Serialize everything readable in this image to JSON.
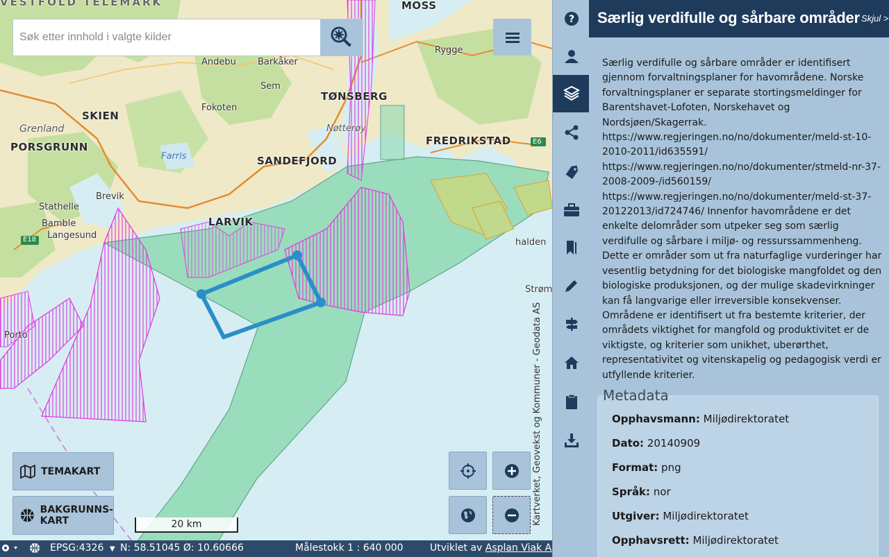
{
  "search": {
    "placeholder": "Søk etter innhold i valgte kilder"
  },
  "map": {
    "labels": {
      "skien": "SKIEN",
      "grenland": "Grenland",
      "porsgrunn": "PORSGRUNN",
      "farris": "Farris",
      "brevik": "Brevik",
      "stathelle": "Stathelle",
      "bamble": "Bamble",
      "langesund": "Langesund",
      "larvik": "LARVIK",
      "sandefjord": "SANDEFJORD",
      "tonsberg": "TØNSBERG",
      "notteroy": "Nøtterøy",
      "fredrikstad": "FREDRIKSTAD",
      "sem": "Sem",
      "barkaker": "Barkåker",
      "andebu": "Andebu",
      "fokoten": "Fokoten",
      "moss": "MOSS",
      "rygge": "Rygge",
      "halden": "halden",
      "strom": "Strøm",
      "porto": "Porto",
      "e18": "E18",
      "e6": "E6",
      "top_band": "VESTFOLD TELEMARK"
    },
    "scale_label": "20 km",
    "attribution": "Kartverket, Geovekst og Kommuner - Geodata AS"
  },
  "buttons": {
    "temakart": "TEMAKART",
    "bakgrunnskart_line1": "BAKGRUNNS-",
    "bakgrunnskart_line2": "KART"
  },
  "statusbar": {
    "projection": "EPSG:4326",
    "coordinates": "N: 58.51045 Ø: 10.60666",
    "scale": "Målestokk 1 : 640 000",
    "developed_by": "Utviklet av",
    "developer": "Asplan Viak AS"
  },
  "rail": {
    "icons": [
      "help-icon",
      "user-icon",
      "layers-icon",
      "share-icon",
      "tag-icon",
      "briefcase-icon",
      "bookmarks-icon",
      "pencil-icon",
      "signpost-icon",
      "home-icon",
      "clipboard-icon",
      "download-icon"
    ]
  },
  "panel": {
    "title": "Særlig verdifulle og sårbare områder",
    "hide": "Skjul >",
    "description": "Særlig verdifulle og sårbare områder er identifisert gjennom forvaltningsplaner for havområdene. Norske forvaltningsplaner er separate stortingsmeldinger for Barentshavet-Lofoten, Norskehavet og Nordsjøen/Skagerrak. https://www.regjeringen.no/no/dokumenter/meld-st-10-2010-2011/id635591/ https://www.regjeringen.no/no/dokumenter/stmeld-nr-37-2008-2009-/id560159/ https://www.regjeringen.no/no/dokumenter/meld-st-37-20122013/id724746/ Innenfor havområdene er det enkelte delområder som utpeker seg som særlig verdifulle og sårbare i miljø- og ressurssammenheng. Dette er områder som ut fra naturfaglige vurderinger har vesentlig betydning for det biologiske mangfoldet og den biologiske produksjonen, og der mulige skadevirkninger kan få langvarige eller irreversible konsekvenser. Områdene er identifisert ut fra bestemte kriterier, der områdets viktighet for mangfold og produktivitet er de viktigste, og kriterier som unikhet, uberørthet, representativitet og vitenskapelig og pedagogisk verdi er utfyllende kriterier.",
    "metadata_title": "Metadata",
    "metadata": [
      {
        "key": "Opphavsmann:",
        "value": "Miljødirektoratet"
      },
      {
        "key": "Dato:",
        "value": "20140909"
      },
      {
        "key": "Format:",
        "value": "png"
      },
      {
        "key": "Språk:",
        "value": "nor"
      },
      {
        "key": "Utgiver:",
        "value": "Miljødirektoratet"
      },
      {
        "key": "Opphavsrett:",
        "value": "Miljødirektoratet"
      }
    ]
  },
  "colors": {
    "land": "#f0ecd0",
    "forest": "#bfdc9a",
    "sea": "#d6eef3",
    "green_zone": "#8fd9b3",
    "magenta": "#e040e0",
    "selection": "#2a8fc8",
    "header": "#1e3b5c",
    "panel": "#a9c4da"
  }
}
